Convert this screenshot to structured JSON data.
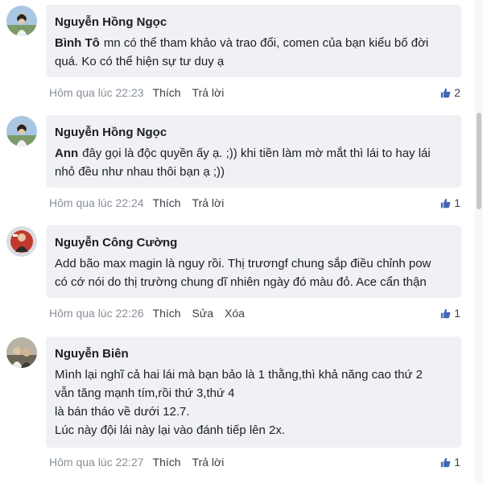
{
  "accent_color": "#4267b2",
  "comments": [
    {
      "author": "Nguyễn Hồng Ngọc",
      "avatar_icon": "user-avatar-icon",
      "mention": "Bình Tô",
      "lines": [
        "mn có thể tham khảo và trao đổi, comen của bạn kiểu bố đời",
        "quá. Ko có thể hiện sự tư duy ạ"
      ],
      "time": "Hôm qua lúc 22:23",
      "actions": [
        "Thích",
        "Trả lời"
      ],
      "likes": "2"
    },
    {
      "author": "Nguyễn Hồng Ngọc",
      "avatar_icon": "user-avatar-icon",
      "mention": "Ann",
      "lines": [
        "đây gọi là độc quyền ấy ạ. ;)) khi tiền làm mờ mắt thì lái to hay lái",
        "nhỏ đều như nhau thôi bạn ạ ;))"
      ],
      "time": "Hôm qua lúc 22:24",
      "actions": [
        "Thích",
        "Trả lời"
      ],
      "likes": "1"
    },
    {
      "author": "Nguyễn Công Cường",
      "avatar_icon": "user-avatar-icon",
      "mention": "",
      "lines": [
        "Add bão max magin là nguy rồi. Thị trươngf chung sắp điều chỉnh pow",
        "có cớ nói do thị trường chung dĩ nhiên ngày đó màu đỏ. Ace cẩn thận"
      ],
      "time": "Hôm qua lúc 22:26",
      "actions": [
        "Thích",
        "Sửa",
        "Xóa"
      ],
      "likes": "1"
    },
    {
      "author": "Nguyễn Biên",
      "avatar_icon": "user-avatar-icon",
      "mention": "",
      "lines": [
        "Mình lại nghĩ cả hai lái mà bạn bảo là 1 thằng,thì khả năng cao thứ 2",
        "vẫn tăng mạnh tím,rồi thứ 3,thứ 4",
        "là bán tháo về dưới 12.7.",
        "Lúc này đội lái này lại vào đánh tiếp lên 2x."
      ],
      "time": "Hôm qua lúc 22:27",
      "actions": [
        "Thích",
        "Trả lời"
      ],
      "likes": "1"
    }
  ]
}
